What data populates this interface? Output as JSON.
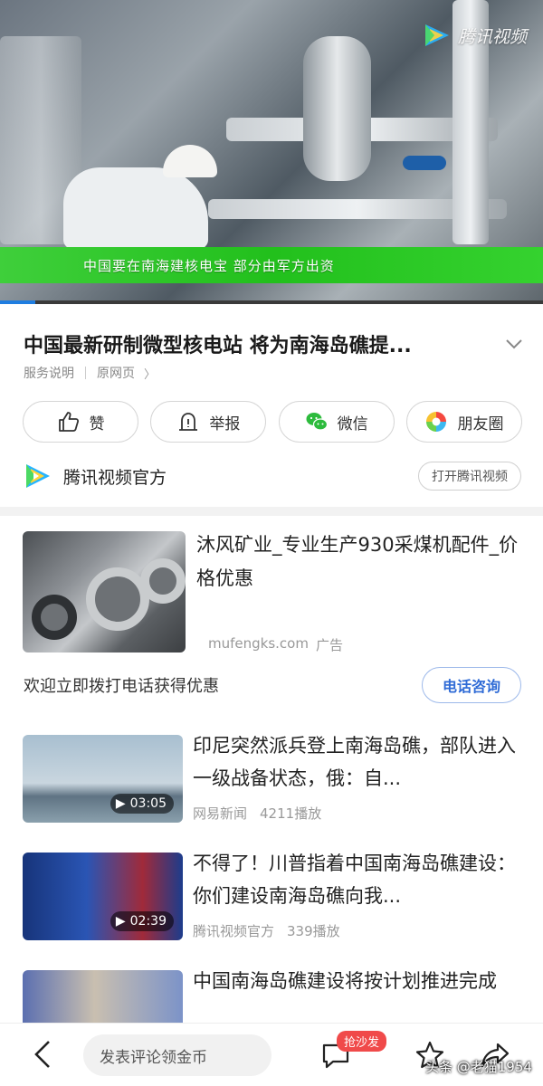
{
  "video": {
    "caption": "中国要在南海建核电宝  部分由军方出资",
    "watermark": "腾讯视频",
    "progress": 0.065
  },
  "article": {
    "title": "中国最新研制微型核电站 将为南海岛礁提...",
    "service_label": "服务说明",
    "original_label": "原网页",
    "original_arrow": "〉"
  },
  "actions": {
    "like_label": "赞",
    "report_label": "举报",
    "wechat_label": "微信",
    "moments_label": "朋友圈"
  },
  "channel": {
    "name": "腾讯视频官方",
    "open_label": "打开腾讯视频"
  },
  "ad": {
    "title": "沐风矿业_专业生产930采煤机配件_价格优惠",
    "domain": "mufengks.com",
    "ad_tag": "广告",
    "cta_text": "欢迎立即拨打电话获得优惠",
    "cta_button": "电话咨询"
  },
  "related": [
    {
      "title": "印尼突然派兵登上南海岛礁，部队进入一级战备状态，俄：自...",
      "source": "网易新闻",
      "plays": "4211播放",
      "duration": "03:05"
    },
    {
      "title": "不得了！川普指着中国南海岛礁建设：你们建设南海岛礁向我...",
      "source": "腾讯视频官方",
      "plays": "339播放",
      "duration": "02:39"
    },
    {
      "title": "中国南海岛礁建设将按计划推进完成",
      "source": "",
      "plays": "",
      "duration": ""
    }
  ],
  "bottom_bar": {
    "comment_placeholder": "发表评论领金币",
    "sofa_badge": "抢沙发",
    "watermark": "头条 @老猫1954"
  },
  "colors": {
    "accent_blue": "#2f6bd6",
    "caption_green": "#22c01c",
    "badge_red": "#f04a4a"
  }
}
